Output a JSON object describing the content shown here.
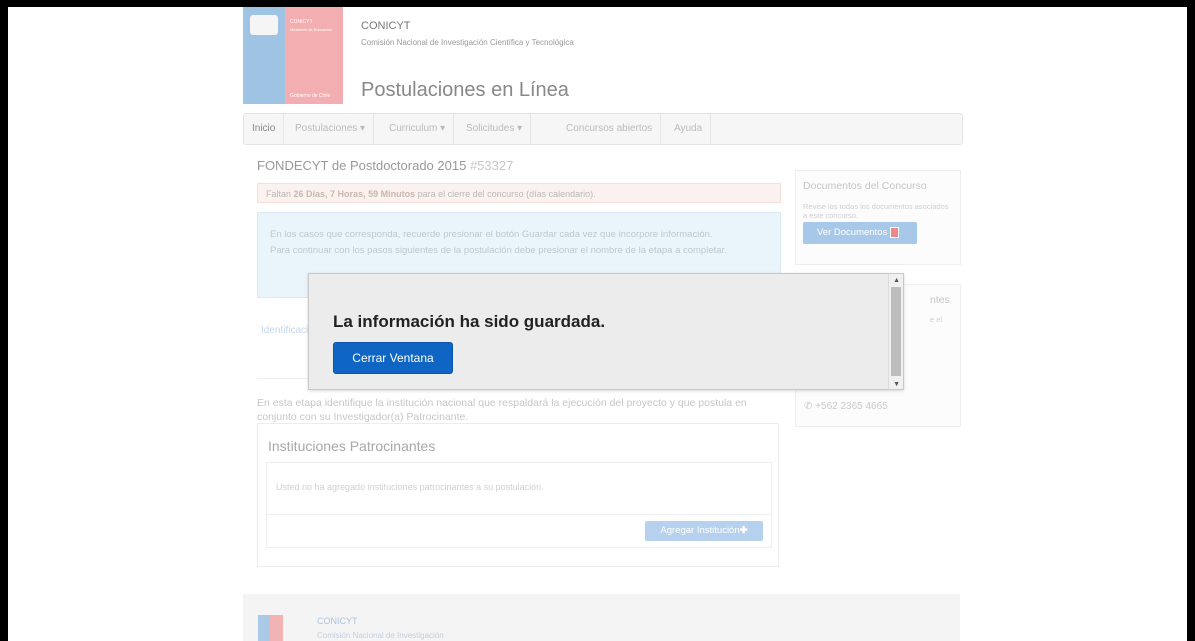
{
  "header": {
    "logo_top": "CONICYT",
    "logo_sub": "Ministerio de Educación",
    "logo_bottom": "Gobierno de Chile",
    "org_name": "CONICYT",
    "org_subtitle": "Comisión Nacional de Investigación Científica y Tecnológica",
    "site_title": "Postulaciones en Línea"
  },
  "nav": {
    "items": [
      {
        "label": "Inicio"
      },
      {
        "label": "Postulaciones ▾"
      },
      {
        "label": "Curriculum ▾"
      },
      {
        "label": "Solicitudes ▾"
      },
      {
        "label": "Concursos abiertos"
      },
      {
        "label": "Ayuda"
      }
    ]
  },
  "main": {
    "title": "FONDECYT de Postdoctorado 2015",
    "number": "#53327",
    "time_prefix": "Faltan",
    "time_value": "26 Días, 7 Horas, 59 Minutos",
    "time_suffix": "para el cierre del concurso (días calendario).",
    "info_line1": "En los casos que corresponda, recuerde presionar el botón Guardar cada vez que incorpore información.",
    "info_line2": "Para continuar con los pasos siguientes de la postulación debe presionar el nombre de la etapa a completar.",
    "ident_link": "Identificación",
    "stage_desc": "En esta etapa identifique la institución nacional que respaldará la ejecución del proyecto y que postula en conjunto con su Investigador(a) Patrocinante.",
    "panel_title": "Instituciones Patrocinantes",
    "empty_msg": "Usted no ha agregado instituciones patrocinantes a su postulación.",
    "add_button": "Agregar Institución"
  },
  "sidebar": {
    "docs_title": "Documentos del Concurso",
    "docs_text": "Revise los todos los documentos asociados a este concurso.",
    "docs_button": "Ver Documentos",
    "box2_title": "ntes",
    "box2_text": "e el",
    "phone": "+562 2365 4665"
  },
  "footer": {
    "name": "CONICYT",
    "subtitle": "Comisión Nacional de Investigación"
  },
  "modal": {
    "message": "La información ha sido guardada.",
    "button": "Cerrar Ventana"
  },
  "colors": {
    "modal_button": "#0e65c4",
    "modal_bg": "#ececec"
  }
}
